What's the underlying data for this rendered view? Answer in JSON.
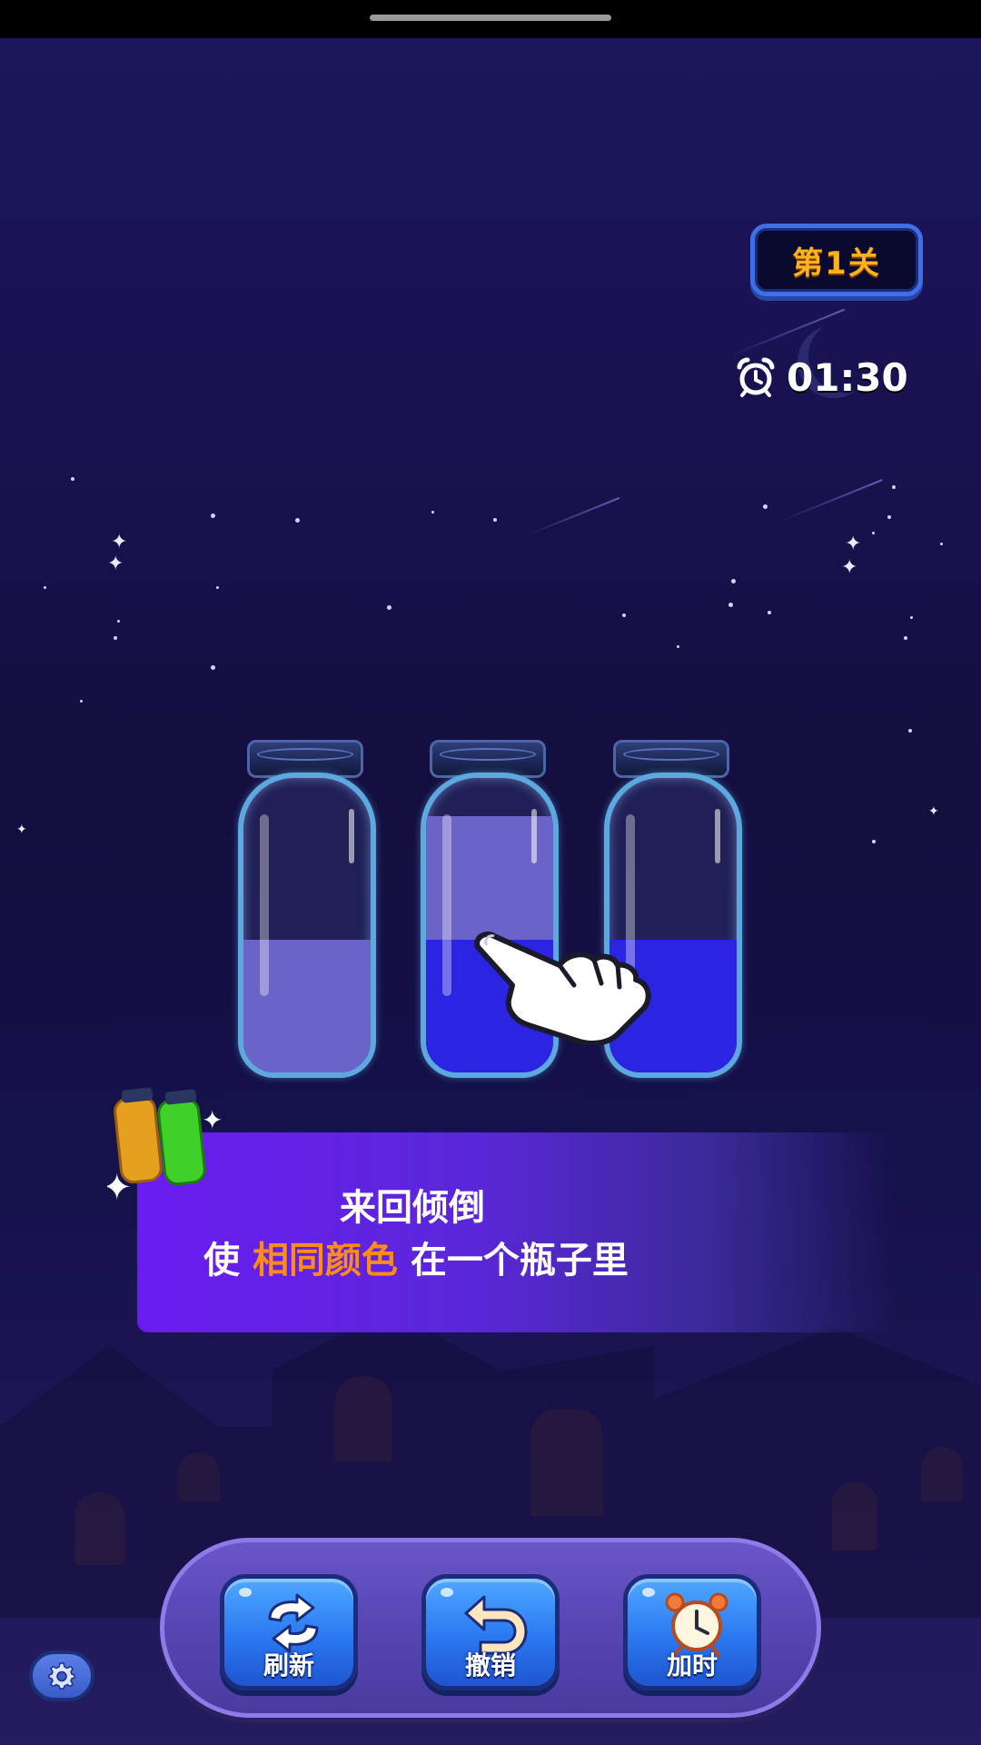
{
  "level": {
    "label": "第1关"
  },
  "timer": {
    "value": "01:30",
    "icon": "alarm-clock-icon"
  },
  "bottles": [
    {
      "layers": [
        "light-purple"
      ],
      "fill": 0.45
    },
    {
      "layers": [
        "blue",
        "light-purple"
      ],
      "fill": 0.82
    },
    {
      "layers": [
        "blue"
      ],
      "fill": 0.45
    }
  ],
  "instruction": {
    "line1": "来回倾倒",
    "line2_prefix": "使 ",
    "line2_highlight": "相同颜色",
    "line2_suffix": " 在一个瓶子里"
  },
  "toolbar": {
    "refresh_label": "刷新",
    "undo_label": "撤销",
    "add_time_label": "加时"
  },
  "colors": {
    "light_purple": "#6b64c8",
    "blue": "#2b24e0",
    "highlight": "#ff8c1a",
    "level_text": "#ffb31a"
  }
}
